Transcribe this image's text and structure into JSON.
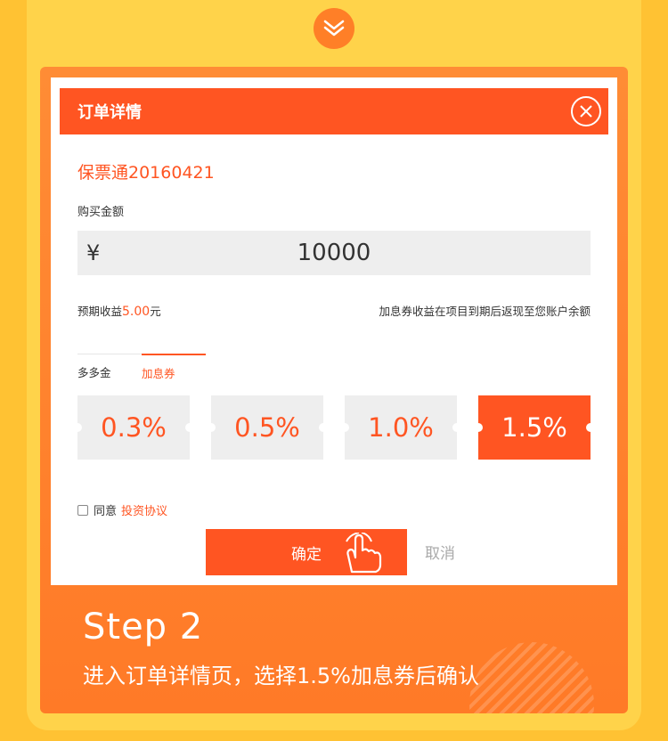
{
  "modal": {
    "title": "订单详情",
    "product_name": "保票通20160421",
    "amount_label": "购买金额",
    "currency": "¥",
    "amount_value": "10000",
    "expected_label": "预期收益",
    "expected_value": "5.00",
    "expected_unit": "元",
    "coupon_note": "加息券收益在项目到期后返现至您账户余额",
    "tabs": [
      {
        "label": "多多金",
        "active": false
      },
      {
        "label": "加息券",
        "active": true
      }
    ],
    "coupons": [
      {
        "label": "0.3%",
        "selected": false
      },
      {
        "label": "0.5%",
        "selected": false
      },
      {
        "label": "1.0%",
        "selected": false
      },
      {
        "label": "1.5%",
        "selected": true
      }
    ],
    "agree_text": "同意",
    "agree_link": "投资协议",
    "confirm_label": "确定",
    "cancel_label": "取消"
  },
  "step": {
    "title": "Step 2",
    "description": "进入订单详情页，选择1.5%加息券后确认"
  },
  "colors": {
    "accent": "#ff5522",
    "background": "#ffc233",
    "card": "#ff7f27"
  },
  "icons": [
    "chevron-double-down-icon",
    "close-icon",
    "hand-pointer-icon"
  ]
}
